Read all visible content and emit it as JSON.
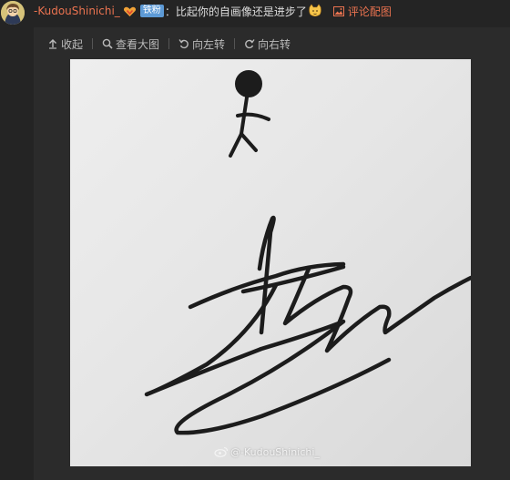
{
  "comment": {
    "username": "-KudouShinichi_",
    "badge": "铁粉",
    "colon": "：",
    "text": "比起你的自画像还是进步了",
    "pic_comment_label": "评论配图"
  },
  "toolbar": {
    "collapse_label": "收起",
    "view_large_label": "查看大图",
    "rotate_left_label": "向左转",
    "rotate_right_label": "向右转"
  },
  "image": {
    "watermark": "@-KudouShinichi_"
  },
  "colors": {
    "accent": "#eb7350",
    "badge": "#5d9ad6",
    "background": "#242424"
  }
}
